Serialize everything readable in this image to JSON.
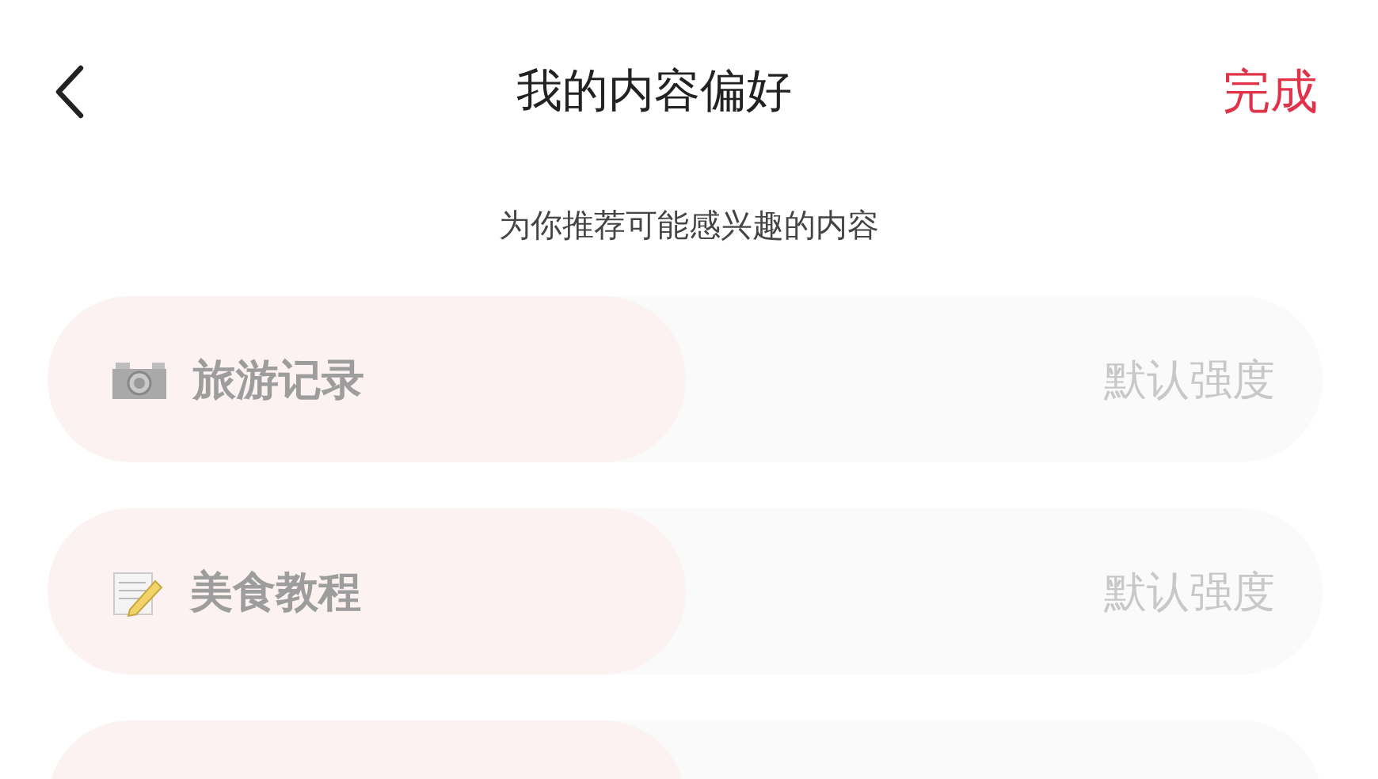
{
  "header": {
    "title": "我的内容偏好",
    "done": "完成"
  },
  "subtitle": "为你推荐可能感兴趣的内容",
  "preferences": [
    {
      "label": "旅游记录",
      "strength": "默认强度",
      "level": 0.5
    },
    {
      "label": "美食教程",
      "strength": "默认强度",
      "level": 0.5
    },
    {
      "level": 0.5
    }
  ]
}
